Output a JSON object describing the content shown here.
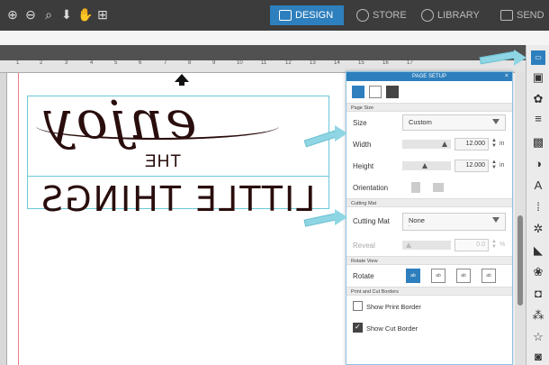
{
  "nav": {
    "design": "DESIGN",
    "store": "STORE",
    "library": "LIBRARY",
    "send": "SEND"
  },
  "ruler": {
    "ticks": [
      "1",
      "2",
      "3",
      "4",
      "5",
      "6",
      "7",
      "8",
      "9",
      "10",
      "11",
      "12",
      "13",
      "14",
      "15",
      "16",
      "17"
    ]
  },
  "design": {
    "script_word": "enjoy",
    "small_word": "THE",
    "bottom_words": "LITTLE THINGS"
  },
  "panel": {
    "title": "PAGE SETUP",
    "close": "×",
    "sections": {
      "page_size": "Page Size",
      "cutting_mat": "Cutting Mat",
      "rotate_view": "Rotate View",
      "borders": "Print and Cut Borders"
    },
    "size_label": "Size",
    "size_value": "Custom",
    "width_label": "Width",
    "width_value": "12.000",
    "height_label": "Height",
    "height_value": "12.000",
    "unit": "in",
    "orientation_label": "Orientation",
    "cutting_mat_label": "Cutting Mat",
    "cutting_mat_value": "None",
    "cutting_mat_sub": "-",
    "reveal_label": "Reveal",
    "reveal_value": "0.0",
    "reveal_unit": "%",
    "rotate_label": "Rotate",
    "rotate_options": [
      "ab",
      "ab",
      "ab",
      "ab"
    ],
    "show_print_border": "Show Print Border",
    "show_cut_border": "Show Cut Border"
  },
  "colors": {
    "accent": "#2e7fbd",
    "callout": "#8fd6e4",
    "ink": "#2a0d0d",
    "cut_line": "#f07a8a"
  }
}
